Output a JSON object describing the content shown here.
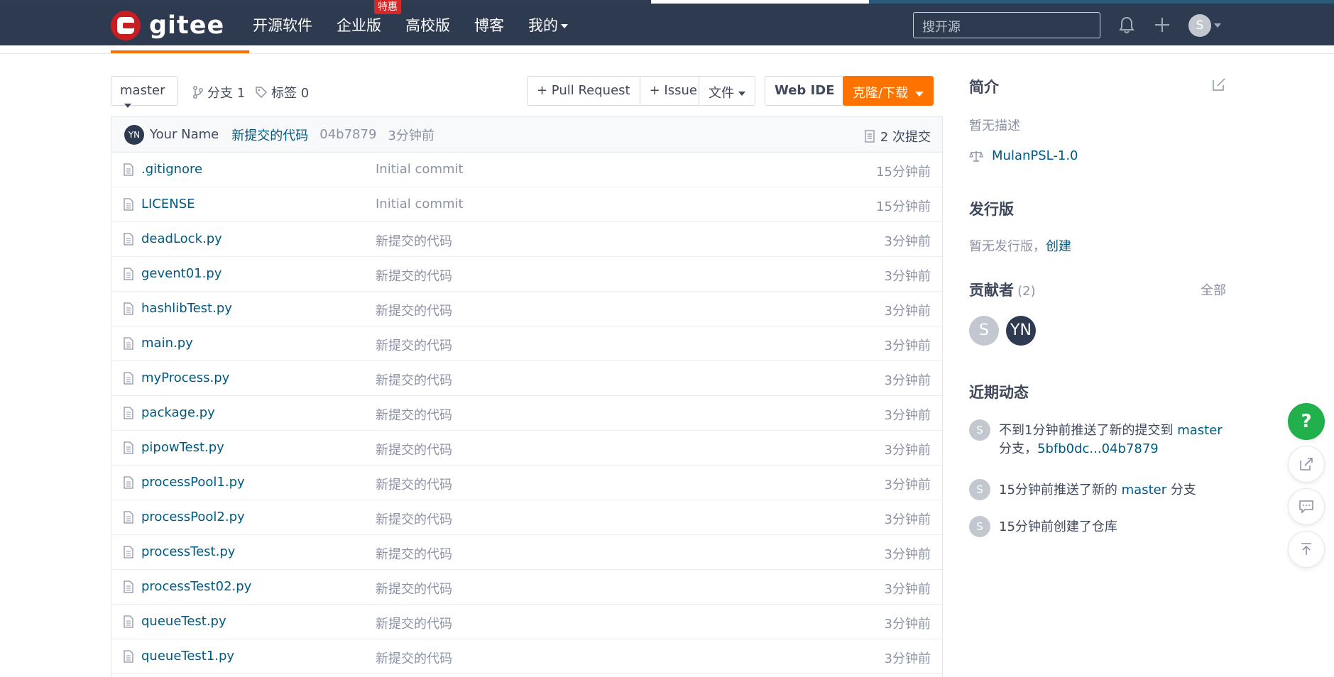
{
  "colors": {
    "header_bg": "#2e3a50",
    "accent": "#fe7300",
    "link": "#005980",
    "help": "#21b04b",
    "badge": "#d62828"
  },
  "header": {
    "logo_text": "gitee",
    "nav": [
      {
        "label": "开源软件"
      },
      {
        "label": "企业版",
        "badge": "特惠"
      },
      {
        "label": "高校版"
      },
      {
        "label": "博客"
      },
      {
        "label": "我的"
      }
    ],
    "search_placeholder": "搜开源",
    "user_initial": "S"
  },
  "toolbar": {
    "branch": "master",
    "branches": "分支 1",
    "tags": "标签 0",
    "pull_request": "+ Pull Request",
    "issue": "+ Issue",
    "file": "文件",
    "web_ide": "Web IDE",
    "clone": "克隆/下载"
  },
  "commit": {
    "avatar": "YN",
    "author": "Your Name",
    "message": "新提交的代码",
    "hash": "04b7879",
    "time": "3分钟前",
    "count": "2 次提交"
  },
  "files": [
    {
      "name": ".gitignore",
      "message": "Initial commit",
      "time": "15分钟前"
    },
    {
      "name": "LICENSE",
      "message": "Initial commit",
      "time": "15分钟前"
    },
    {
      "name": "deadLock.py",
      "message": "新提交的代码",
      "time": "3分钟前"
    },
    {
      "name": "gevent01.py",
      "message": "新提交的代码",
      "time": "3分钟前"
    },
    {
      "name": "hashlibTest.py",
      "message": "新提交的代码",
      "time": "3分钟前"
    },
    {
      "name": "main.py",
      "message": "新提交的代码",
      "time": "3分钟前"
    },
    {
      "name": "myProcess.py",
      "message": "新提交的代码",
      "time": "3分钟前"
    },
    {
      "name": "package.py",
      "message": "新提交的代码",
      "time": "3分钟前"
    },
    {
      "name": "pipowTest.py",
      "message": "新提交的代码",
      "time": "3分钟前"
    },
    {
      "name": "processPool1.py",
      "message": "新提交的代码",
      "time": "3分钟前"
    },
    {
      "name": "processPool2.py",
      "message": "新提交的代码",
      "time": "3分钟前"
    },
    {
      "name": "processTest.py",
      "message": "新提交的代码",
      "time": "3分钟前"
    },
    {
      "name": "processTest02.py",
      "message": "新提交的代码",
      "time": "3分钟前"
    },
    {
      "name": "queueTest.py",
      "message": "新提交的代码",
      "time": "3分钟前"
    },
    {
      "name": "queueTest1.py",
      "message": "新提交的代码",
      "time": "3分钟前"
    }
  ],
  "sidebar": {
    "intro_title": "简介",
    "intro_text": "暂无描述",
    "license": "MulanPSL-1.0",
    "release_title": "发行版",
    "release_text": "暂无发行版，",
    "release_create": "创建",
    "contrib_title": "贡献者",
    "contrib_count": "(2)",
    "contrib_all": "全部",
    "contributors": [
      "S",
      "YN"
    ],
    "activity_title": "近期动态",
    "activity": [
      {
        "avatar": "S",
        "pre": "不到1分钟前推送了新的提交到 ",
        "branch": "master",
        "mid": " 分支，",
        "range": "5bfb0dc...04b7879"
      },
      {
        "avatar": "S",
        "pre": "15分钟前推送了新的 ",
        "branch": "master",
        "mid": " 分支"
      },
      {
        "avatar": "S",
        "pre": "15分钟前创建了仓库"
      }
    ]
  },
  "floating": {
    "help": "?"
  }
}
